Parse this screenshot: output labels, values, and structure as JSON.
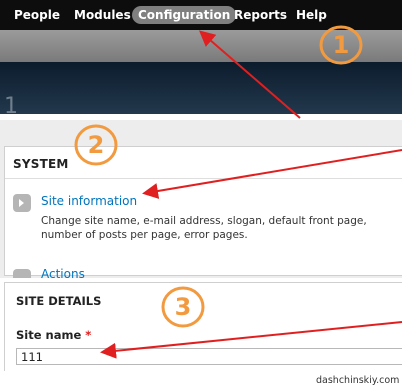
{
  "admin_menu": {
    "items": [
      {
        "label": "People",
        "active": false
      },
      {
        "label": "Modules",
        "active": false
      },
      {
        "label": "Configuration",
        "active": true
      },
      {
        "label": "Reports",
        "active": false
      },
      {
        "label": "Help",
        "active": false
      }
    ]
  },
  "page_title_fragment": "1",
  "system_section": {
    "heading": "SYSTEM",
    "site_information": {
      "link": "Site information",
      "description": "Change site name, e-mail address, slogan, default front page, number of posts per page, error pages."
    },
    "next_item_link": "Actions"
  },
  "site_details": {
    "heading": "SITE DETAILS",
    "site_name_label": "Site name",
    "required_marker": "*",
    "site_name_value": "111"
  },
  "annotations": {
    "steps": [
      "1",
      "2",
      "3"
    ],
    "color": "#f29a3f",
    "arrow_color": "#e02020"
  },
  "watermark": "dashchinskiy.com"
}
